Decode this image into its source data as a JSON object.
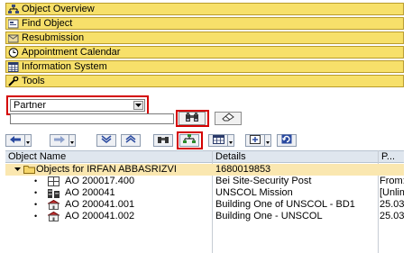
{
  "nav": {
    "items": [
      {
        "label": "Object Overview",
        "icon": "org-structure-icon"
      },
      {
        "label": "Find Object",
        "icon": "find-object-icon"
      },
      {
        "label": "Resubmission",
        "icon": "resubmission-icon"
      },
      {
        "label": "Appointment Calendar",
        "icon": "clock-icon"
      },
      {
        "label": "Information System",
        "icon": "table-icon"
      },
      {
        "label": "Tools",
        "icon": "tools-icon"
      }
    ]
  },
  "search": {
    "object_type": "Partner",
    "query_value": ""
  },
  "grid": {
    "columns": [
      "Object Name",
      "Details",
      "P..."
    ],
    "rows": [
      {
        "name": "Objects for IRFAN ABBASRIZVI",
        "details": "1680019853",
        "p": "",
        "icon": "folder-icon",
        "expanded": true,
        "highlight": true
      },
      {
        "name": "AO 200017.400",
        "details": "Bei Site-Security Post",
        "p": "From:",
        "icon": "rental-object-icon"
      },
      {
        "name": "AO 200041",
        "details": "UNSCOL Mission",
        "p": "[Unlim",
        "icon": "building-complex-icon"
      },
      {
        "name": "AO 200041.001",
        "details": "Building One of UNSCOL - BD1",
        "p": "25.03.",
        "icon": "building-icon"
      },
      {
        "name": "AO 200041.002",
        "details": "Building One - UNSCOL",
        "p": "25.03.",
        "icon": "building-icon"
      }
    ]
  },
  "colors": {
    "nav_bg": "#f7e06a",
    "highlight_row": "#fae7b0",
    "red_marker": "#d40000"
  }
}
